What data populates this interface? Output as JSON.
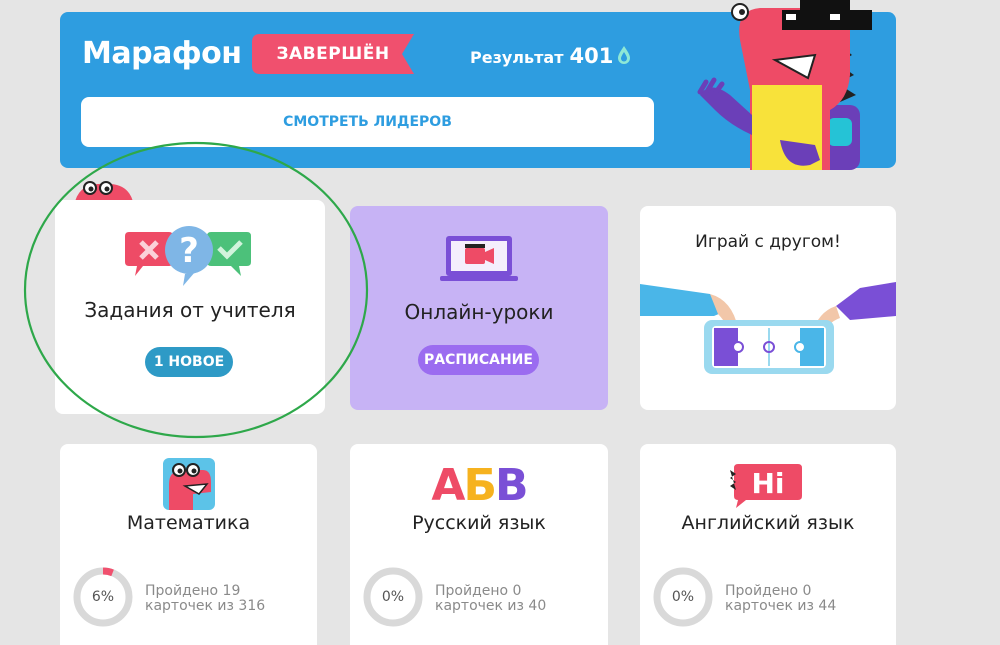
{
  "banner": {
    "title": "Марафон",
    "status": "ЗАВЕРШЁН",
    "result_label": "Результат",
    "result_value": "401",
    "leaders_button": "СМОТРЕТЬ ЛИДЕРОВ"
  },
  "cards": {
    "teacher": {
      "title": "Задания от учителя",
      "badge": "1 НОВОЕ"
    },
    "online": {
      "title": "Онлайн-уроки",
      "badge": "РАСПИСАНИЕ"
    },
    "friend": {
      "title": "Играй с другом!"
    },
    "math": {
      "title": "Математика",
      "percent": "6%",
      "progress": 0.06,
      "line1": "Пройдено 19",
      "line2": "карточек из 316"
    },
    "russian": {
      "title": "Русский язык",
      "percent": "0%",
      "progress": 0,
      "line1": "Пройдено 0",
      "line2": "карточек из 40",
      "letters": [
        "А",
        "Б",
        "В"
      ]
    },
    "english": {
      "title": "Английский язык",
      "percent": "0%",
      "progress": 0,
      "line1": "Пройдено 0",
      "line2": "карточек из 44",
      "bubble": "Hi"
    }
  },
  "colors": {
    "banner_blue": "#2e9de0",
    "status_red": "#f0506e",
    "badge_blue": "#2e9ac6",
    "badge_purple": "#9b6cf0",
    "online_bg": "#c7b3f5",
    "annotation_green": "#2ea84a",
    "progress_red": "#f0506e",
    "progress_track": "#d9d9d9"
  }
}
